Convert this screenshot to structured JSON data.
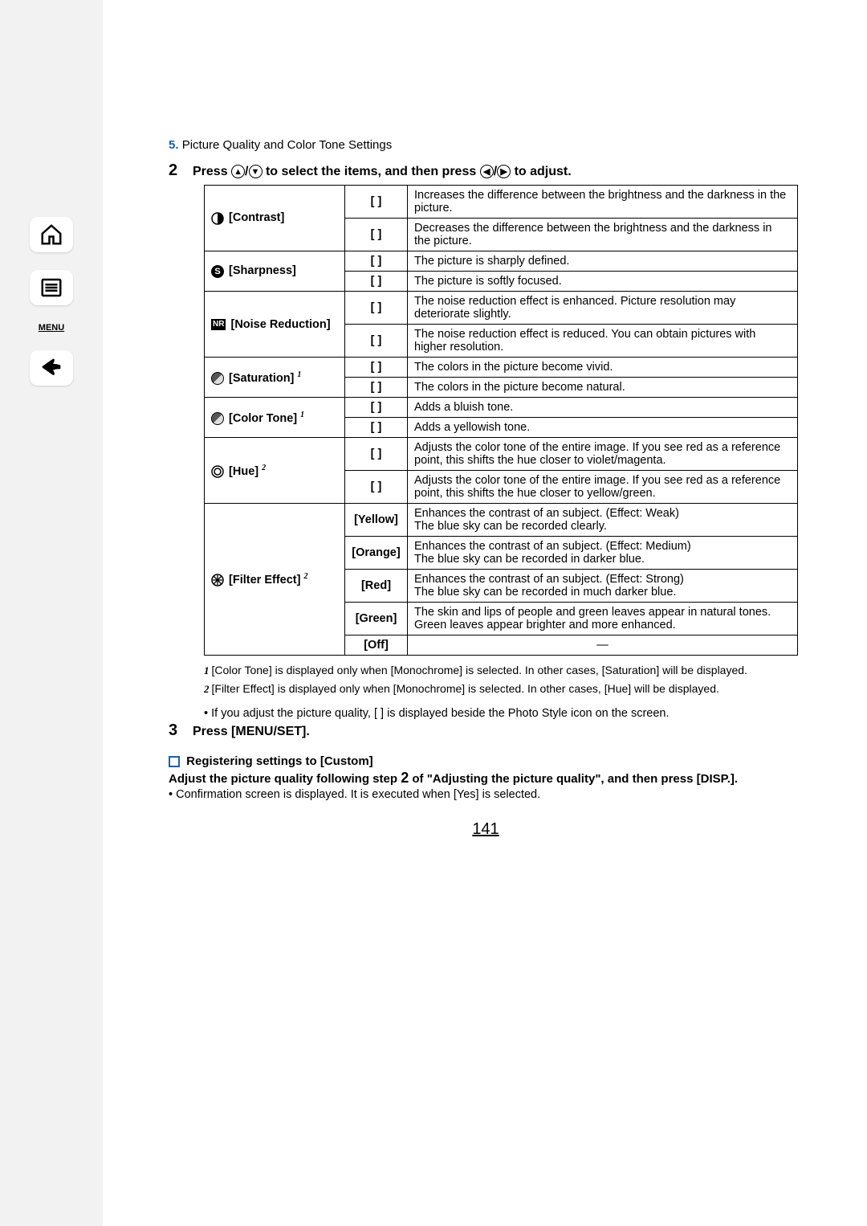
{
  "breadcrumb": {
    "num": "5.",
    "text": "Picture Quality and Color Tone Settings"
  },
  "step2": {
    "num": "2",
    "text_a": "Press ",
    "text_b": " to select the items, and then press ",
    "text_c": " to adjust."
  },
  "table": {
    "contrast": {
      "label": "[Contrast]",
      "rows": [
        {
          "v": "[ ]",
          "d": "Increases the difference between the brightness and the darkness in the picture."
        },
        {
          "v": "[ ]",
          "d": "Decreases the difference between the brightness and the darkness in the picture."
        }
      ]
    },
    "sharpness": {
      "label": "[Sharpness]",
      "rows": [
        {
          "v": "[  ]",
          "d": "The picture is sharply defined."
        },
        {
          "v": "[  ]",
          "d": "The picture is softly focused."
        }
      ]
    },
    "nr": {
      "label": "[Noise Reduction]",
      "rows": [
        {
          "v": "[ ]",
          "d": "The noise reduction effect is enhanced. Picture resolution may deteriorate slightly."
        },
        {
          "v": "[ ]",
          "d": "The noise reduction effect is reduced. You can obtain pictures with higher resolution."
        }
      ]
    },
    "saturation": {
      "label": "[Saturation]",
      "rows": [
        {
          "v": "[  ]",
          "d": "The colors in the picture become vivid."
        },
        {
          "v": "[  ]",
          "d": "The colors in the picture become natural."
        }
      ]
    },
    "colortone": {
      "label": "[Color Tone]",
      "rows": [
        {
          "v": "[  ]",
          "d": "Adds a bluish tone."
        },
        {
          "v": "[  ]",
          "d": "Adds a yellowish tone."
        }
      ]
    },
    "hue": {
      "label": "[Hue]",
      "rows": [
        {
          "v": "[ ]",
          "d": "Adjusts the color tone of the entire image. If you see red as a reference point, this shifts the hue closer to violet/magenta."
        },
        {
          "v": "[ ]",
          "d": "Adjusts the color tone of the entire image. If you see red as a reference point, this shifts the hue closer to yellow/green."
        }
      ]
    },
    "filter": {
      "label": "[Filter Effect]",
      "rows": [
        {
          "v": "[Yellow]",
          "d": "Enhances the contrast of an subject. (Effect: Weak)\nThe blue sky can be recorded clearly."
        },
        {
          "v": "[Orange]",
          "d": "Enhances the contrast of an subject. (Effect: Medium)\nThe blue sky can be recorded in darker blue."
        },
        {
          "v": "[Red]",
          "d": "Enhances the contrast of an subject. (Effect: Strong)\nThe blue sky can be recorded in much darker blue."
        },
        {
          "v": "[Green]",
          "d": "The skin and lips of people and green leaves appear in natural tones.\nGreen leaves appear brighter and more enhanced."
        },
        {
          "v": "[Off]",
          "d": "—"
        }
      ]
    }
  },
  "footnotes": {
    "f1": "[Color Tone] is displayed only when [Monochrome] is selected. In other cases, [Saturation] will be displayed.",
    "f2": "[Filter Effect] is displayed only when [Monochrome] is selected. In other cases, [Hue] will be displayed."
  },
  "bullet": "If you adjust the picture quality, [   ] is displayed beside the Photo Style icon on the screen.",
  "step3": {
    "num": "3",
    "text": "Press [MENU/SET]."
  },
  "register": {
    "title": "Registering settings to [Custom]",
    "body_a": "Adjust the picture quality following step ",
    "body_step": "2",
    "body_b": " of \"Adjusting the picture quality\", and then press ",
    "disp": "[DISP.]",
    "body_c": ".",
    "note": "Confirmation screen is displayed. It is executed when [Yes] is selected."
  },
  "page": "141"
}
